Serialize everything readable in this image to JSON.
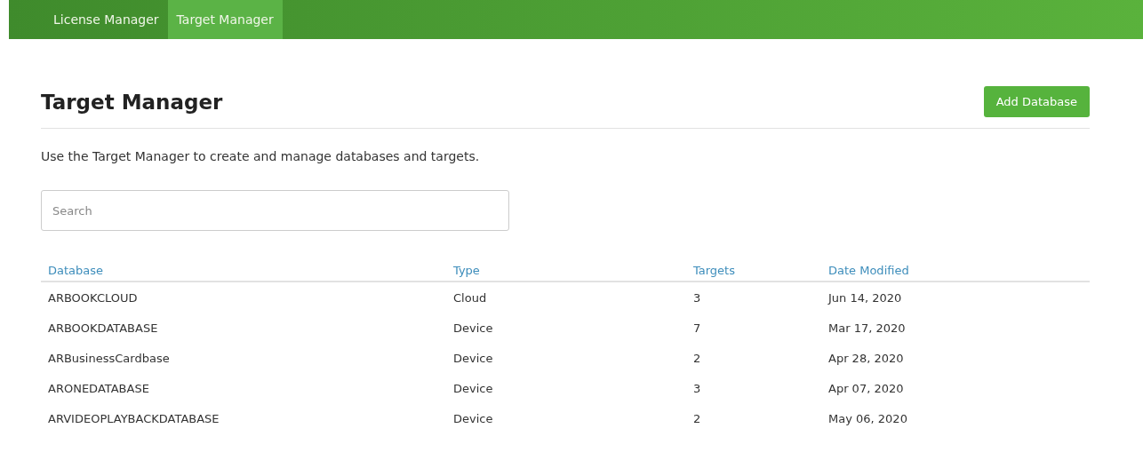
{
  "nav": {
    "tabs": [
      {
        "label": "License Manager",
        "selected": false
      },
      {
        "label": "Target Manager",
        "selected": true
      }
    ]
  },
  "header": {
    "title": "Target Manager",
    "button": "Add Database"
  },
  "description": "Use the Target Manager to create and manage databases and targets.",
  "search": {
    "placeholder": "Search"
  },
  "table": {
    "columns": [
      "Database",
      "Type",
      "Targets",
      "Date Modified"
    ],
    "rows": [
      [
        "ARBOOKCLOUD",
        "Cloud",
        "3",
        "Jun 14, 2020"
      ],
      [
        "ARBOOKDATABASE",
        "Device",
        "7",
        "Mar 17, 2020"
      ],
      [
        "ARBusinessCardbase",
        "Device",
        "2",
        "Apr 28, 2020"
      ],
      [
        "ARONEDATABASE",
        "Device",
        "3",
        "Apr 07, 2020"
      ],
      [
        "ARVIDEOPLAYBACKDATABASE",
        "Device",
        "2",
        "May 06, 2020"
      ]
    ]
  }
}
